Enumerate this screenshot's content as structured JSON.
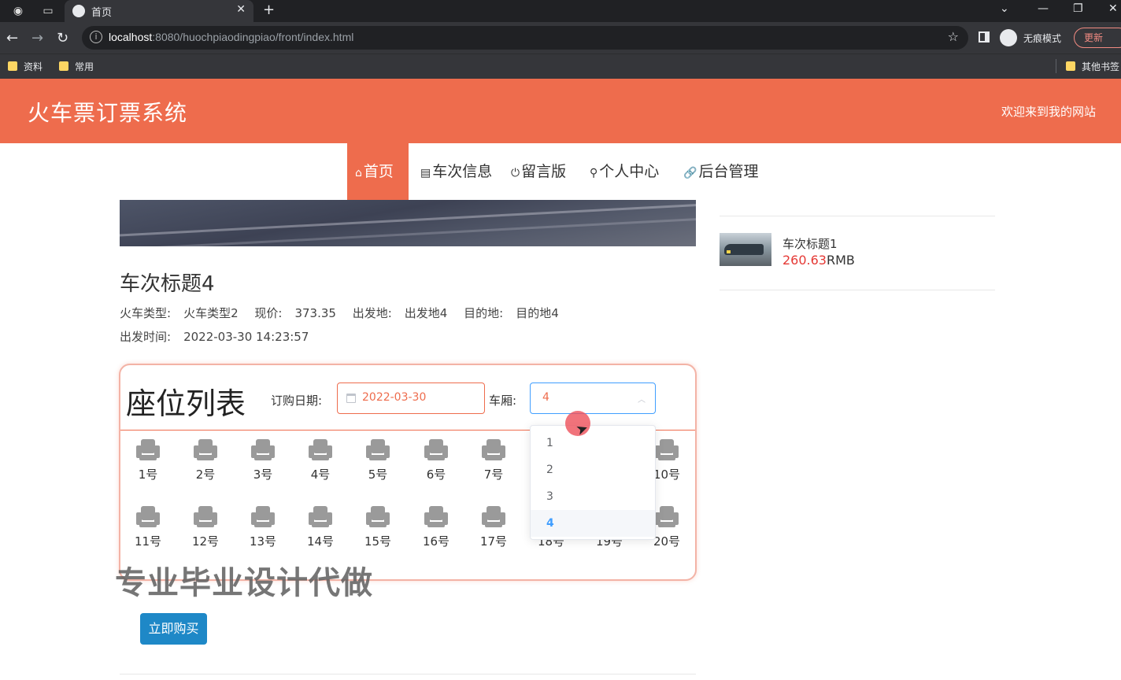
{
  "browser": {
    "tab_title": "首页",
    "url_host": "localhost",
    "url_path": ":8080/huochpiaodingpiao/front/index.html",
    "incognito_label": "无痕模式",
    "update_label": "更新",
    "bookmarks": [
      "资料",
      "常用"
    ],
    "other_bookmarks": "其他书签"
  },
  "site": {
    "title": "火车票订票系统",
    "welcome": "欢迎来到我的网站"
  },
  "nav": {
    "items": [
      {
        "icon": "⌂",
        "label": "首页"
      },
      {
        "icon": "▤",
        "label": "车次信息"
      },
      {
        "icon": "⏻",
        "label": "留言版"
      },
      {
        "icon": "⚲",
        "label": "个人中心"
      },
      {
        "icon": "🔗",
        "label": "后台管理"
      }
    ]
  },
  "detail": {
    "title": "车次标题4",
    "train_type_label": "火车类型:",
    "train_type": "火车类型2",
    "price_label": "现价:",
    "price": "373.35",
    "from_label": "出发地:",
    "from": "出发地4",
    "to_label": "目的地:",
    "to": "目的地4",
    "depart_label": "出发时间:",
    "depart_time": "2022-03-30 14:23:57"
  },
  "seats": {
    "heading": "座位列表",
    "date_label": "订购日期:",
    "date_value": "2022-03-30",
    "car_label": "车厢:",
    "car_value": "4",
    "options": [
      "1",
      "2",
      "3",
      "4"
    ],
    "row1": [
      "1号",
      "2号",
      "3号",
      "4号",
      "5号",
      "6号",
      "7号",
      "10号"
    ],
    "row2": [
      "11号",
      "12号",
      "13号",
      "14号",
      "15号",
      "16号",
      "17号",
      "18号",
      "19号",
      "20号"
    ]
  },
  "watermark": "专业毕业设计代做",
  "buy_label": "立即购买",
  "sidebar": {
    "item_title": "车次标题1",
    "item_price": "260.63",
    "item_currency": "RMB"
  },
  "colors": {
    "accent": "#ee6c4d",
    "select_blue": "#409eff",
    "button_blue": "#1e88c7",
    "price_red": "#e53935"
  }
}
